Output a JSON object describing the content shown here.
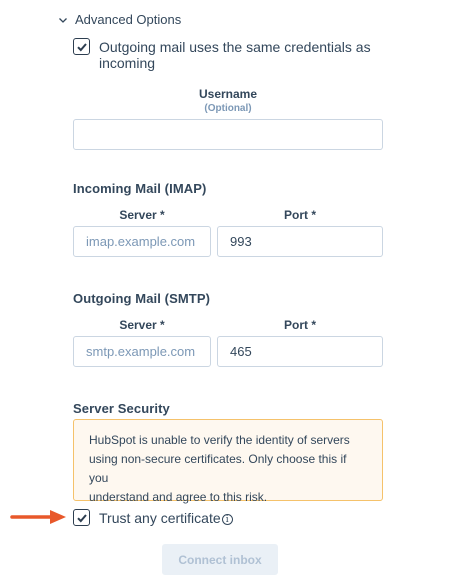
{
  "advanced_options": {
    "label": "Advanced Options"
  },
  "same_credentials": {
    "label_line1": "Outgoing mail uses the same credentials as",
    "label_line2": "incoming",
    "checked": true
  },
  "username": {
    "label": "Username",
    "sublabel": "(Optional)",
    "value": ""
  },
  "incoming": {
    "title": "Incoming Mail (IMAP)",
    "server_label": "Server *",
    "server_placeholder": "imap.example.com",
    "port_label": "Port *",
    "port_value": "993"
  },
  "outgoing": {
    "title": "Outgoing Mail (SMTP)",
    "server_label": "Server *",
    "server_placeholder": "smtp.example.com",
    "port_label": "Port *",
    "port_value": "465"
  },
  "security": {
    "title": "Server Security",
    "alert_line1": "HubSpot is unable to verify the identity of servers",
    "alert_line2": "using non-secure certificates. Only choose this if you",
    "alert_line3": "understand and agree to this risk.",
    "trust_label": "Trust any certificate",
    "trust_checked": true
  },
  "connect_button": {
    "label": "Connect inbox"
  },
  "colors": {
    "arrow": "#e8582a",
    "alert_bg": "#fef8f0",
    "alert_border": "#f5c26b"
  },
  "icons": [
    "chevron-down-icon",
    "checkmark-icon",
    "info-icon",
    "arrow-right-icon"
  ]
}
